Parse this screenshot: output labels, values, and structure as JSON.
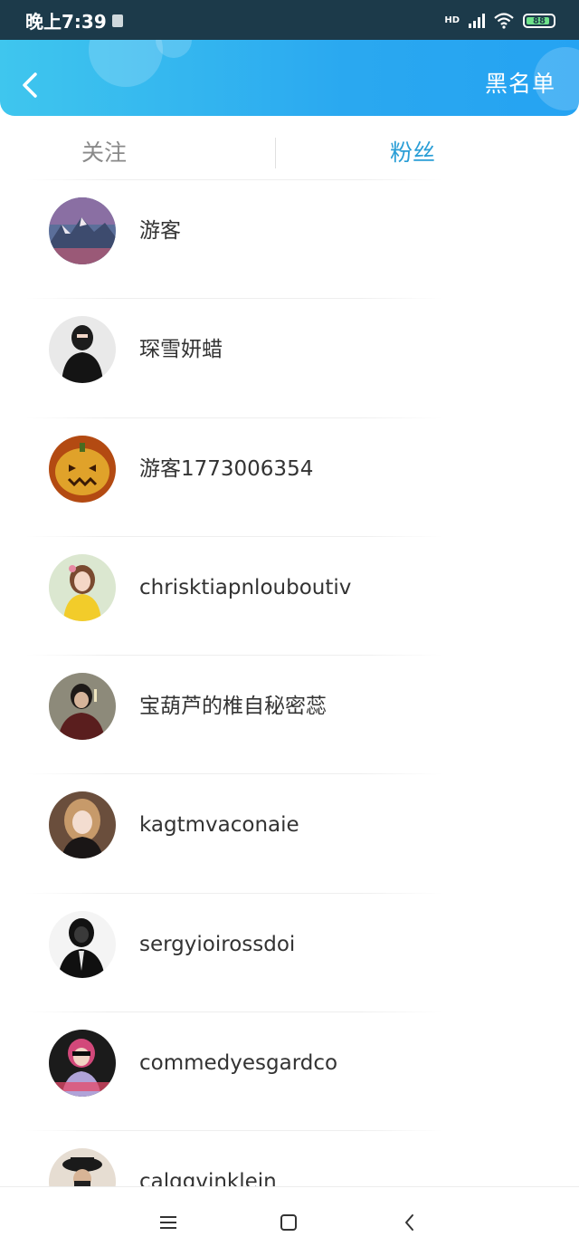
{
  "status_bar": {
    "time": "晚上7:39",
    "signal": "HD",
    "battery": "88",
    "battery_fraction": 0.88
  },
  "header": {
    "back_icon": "chevron-left-icon",
    "blacklist_label": "黑名单"
  },
  "tabs": {
    "follow": "关注",
    "fans": "粉丝",
    "active": "fans"
  },
  "users": [
    {
      "name": "游客"
    },
    {
      "name": "琛雪妍蜡"
    },
    {
      "name": "游客1773006354"
    },
    {
      "name": "chrisktiapnlouboutiv"
    },
    {
      "name": "宝葫芦的椎自秘密蕊"
    },
    {
      "name": "kagtmvaconaie"
    },
    {
      "name": "sergyioirossdoi"
    },
    {
      "name": "commedyesgardco"
    },
    {
      "name": "calggvinklein"
    }
  ],
  "colors": {
    "header_start": "#3fc6ee",
    "header_end": "#25a3f2",
    "active_tab": "#2a9ed6",
    "inactive_tab": "#8a8a8a",
    "status_bar": "#1c3a4a"
  },
  "nav_bar": {
    "menu_icon": "menu-icon",
    "home_icon": "home-square-icon",
    "back_icon": "back-triangle-icon"
  }
}
